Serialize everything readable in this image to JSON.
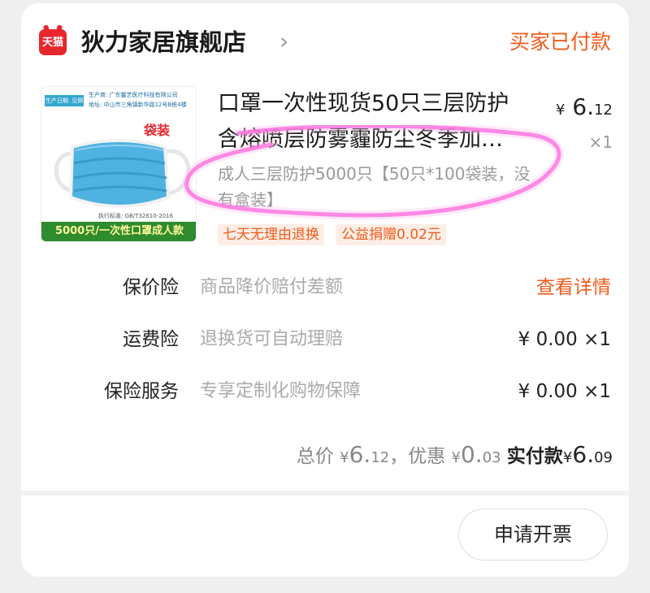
{
  "store": {
    "badge": "天猫",
    "name": "狄力家居旗舰店",
    "chevron": "›",
    "status": "买家已付款"
  },
  "product": {
    "image": {
      "tag": "生产日期: 见侧",
      "maker": "生产商: 广东馨艺医疗科技有限公司",
      "address": "地址: 中山市三角镇新华路12号B栋4楼",
      "bag": "袋装",
      "standard": "执行标准: GB/T32610-2016",
      "banner": "5000只/一次性口罩成人款"
    },
    "title_line1": "口罩一次性现货50只三层防护",
    "title_line2": "含熔喷层防雾霾防尘冬季加…",
    "sku": "成人三层防护5000只【50只*100袋装，没有盒装】",
    "price_symbol": "¥",
    "price_int": "6.",
    "price_dec": "12",
    "quantity": "×1",
    "tags": [
      "七天无理由退换",
      "公益捐赠0.02元"
    ]
  },
  "services": [
    {
      "label": "保价险",
      "desc": "商品降价赔付差额",
      "value": "查看详情"
    },
    {
      "label": "运费险",
      "desc": "退换货可自动理赔",
      "value": "¥ 0.00 ×1"
    },
    {
      "label": "保险服务",
      "desc": "专享定制化购物保障",
      "value": "¥ 0.00 ×1"
    }
  ],
  "totals": {
    "total_label": "总价",
    "total_symbol": "¥",
    "total_int": "6.",
    "total_dec": "12",
    "sep": "，",
    "discount_label": "优惠",
    "discount_symbol": "¥",
    "discount_int": "0.",
    "discount_dec": "03",
    "paid_label": "实付款",
    "paid_symbol": "¥",
    "paid_int": "6.",
    "paid_dec": "09"
  },
  "invoice_button": "申请开票",
  "colors": {
    "accent": "#f25b1b",
    "tmall_red": "#e8262d",
    "highlight": "#ff4fd8"
  }
}
